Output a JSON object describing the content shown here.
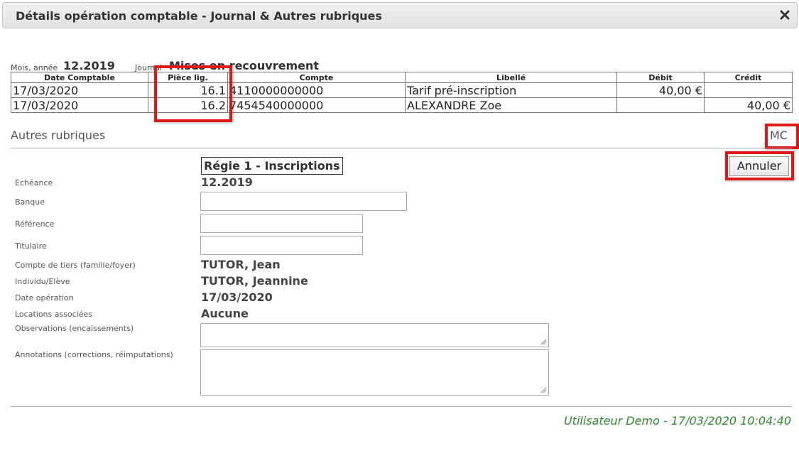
{
  "dialog": {
    "title": "Détails opération comptable - Journal & Autres rubriques",
    "close_icon": "close-icon"
  },
  "header": {
    "mois_label": "Mois, année",
    "mois_value": "12.2019",
    "journal_label": "Journal",
    "journal_value": "Mises en recouvrement"
  },
  "journal_table": {
    "columns": [
      "Date Comptable",
      "Pièce lig.",
      "Compte",
      "Libellé",
      "Débit",
      "Crédit"
    ],
    "rows": [
      {
        "date": "17/03/2020",
        "piece": "16.1",
        "compte": "4110000000000",
        "libelle": "Tarif pré-inscription",
        "debit": "40,00 €",
        "credit": ""
      },
      {
        "date": "17/03/2020",
        "piece": "16.2",
        "compte": "7454540000000",
        "libelle": "ALEXANDRE Zoe",
        "debit": "",
        "credit": "40,00 €"
      }
    ]
  },
  "autres": {
    "section_title": "Autres rubriques",
    "mc_label": "MC",
    "cancel_button": "Annuler",
    "regie": "Régie 1 - Inscriptions",
    "fields": {
      "echeance_label": "Echéance",
      "echeance_value": "12.2019",
      "banque_label": "Banque",
      "banque_value": "",
      "reference_label": "Référence",
      "reference_value": "",
      "titulaire_label": "Titulaire",
      "titulaire_value": "",
      "tiers_label": "Compte de tiers (famille/foyer)",
      "tiers_value": "TUTOR, Jean",
      "individu_label": "Individu/Elève",
      "individu_value": "TUTOR, Jeannine",
      "date_op_label": "Date opération",
      "date_op_value": "17/03/2020",
      "locations_label": "Locations associées",
      "locations_value": "Aucune",
      "observations_label": "Observations (encaissements)",
      "observations_value": "",
      "annotations_label": "Annotations (corrections, réimputations)",
      "annotations_value": ""
    }
  },
  "footer": {
    "user_stamp": "Utilisateur Demo - 17/03/2020 10:04:40"
  },
  "colors": {
    "highlight": "#e21818",
    "footer_text": "#2e8b2e"
  }
}
